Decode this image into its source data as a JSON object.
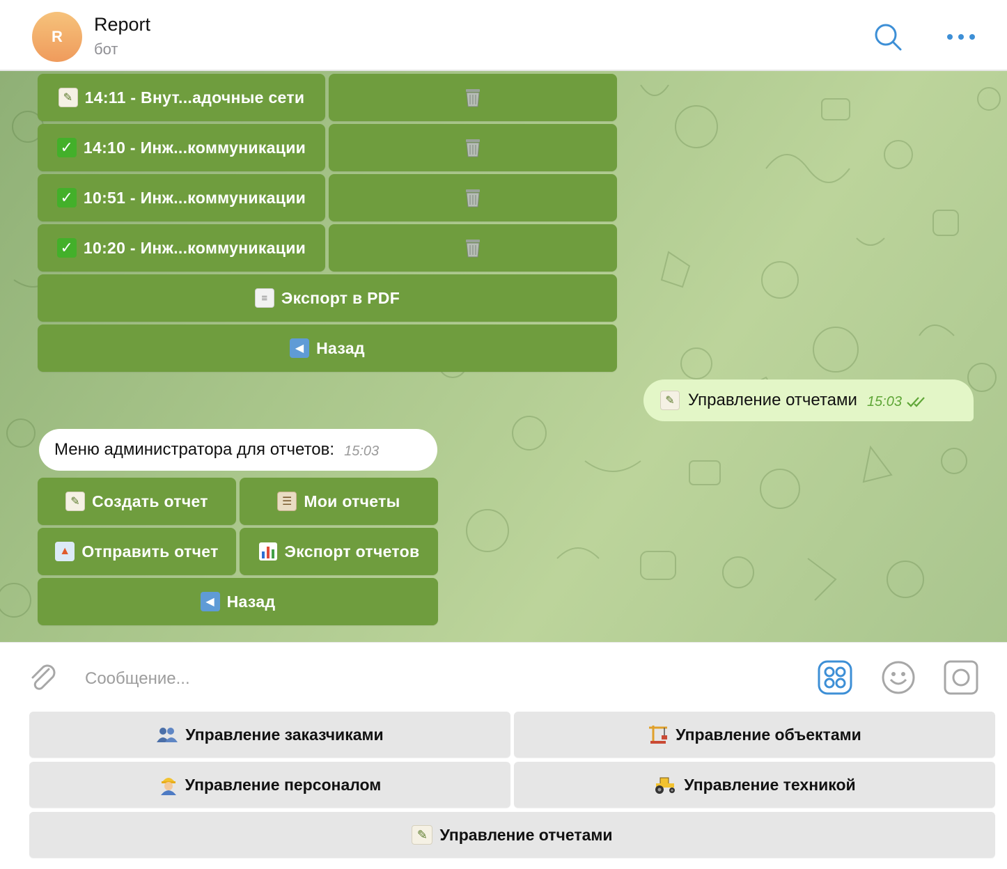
{
  "header": {
    "avatar_letter": "R",
    "title": "Report",
    "subtitle": "бот",
    "search_icon": "search-icon",
    "more_icon": "more-icon"
  },
  "chat": {
    "report_rows": [
      {
        "status_icon": "memo-icon",
        "label": "14:11 - Внут...адочные сети",
        "delete_icon": "trash-icon"
      },
      {
        "status_icon": "check-icon",
        "label": "14:10 - Инж...коммуникации",
        "delete_icon": "trash-icon"
      },
      {
        "status_icon": "check-icon",
        "label": "10:51 - Инж...коммуникации",
        "delete_icon": "trash-icon"
      },
      {
        "status_icon": "check-icon",
        "label": "10:20 - Инж...коммуникации",
        "delete_icon": "trash-icon"
      }
    ],
    "export_pdf_label": "Экспорт в PDF",
    "back_label_top": "Назад",
    "outgoing": {
      "text": "Управление отчетами",
      "time": "15:03"
    },
    "incoming": {
      "text": "Меню администратора для отчетов:",
      "time": "15:03"
    },
    "admin_menu": {
      "create_label": "Создать отчет",
      "my_reports_label": "Мои отчеты",
      "send_label": "Отправить отчет",
      "export_reports_label": "Экспорт отчетов",
      "back_label": "Назад"
    }
  },
  "composer": {
    "placeholder": "Сообщение..."
  },
  "keyboard": {
    "customers_label": "Управление заказчиками",
    "objects_label": "Управление объектами",
    "staff_label": "Управление персоналом",
    "equipment_label": "Управление техникой",
    "reports_label": "Управление отчетами"
  },
  "colors": {
    "inline_button": "#6f9d3e",
    "outgoing_bubble": "#e3f6c7",
    "accent": "#3d8fd6"
  }
}
